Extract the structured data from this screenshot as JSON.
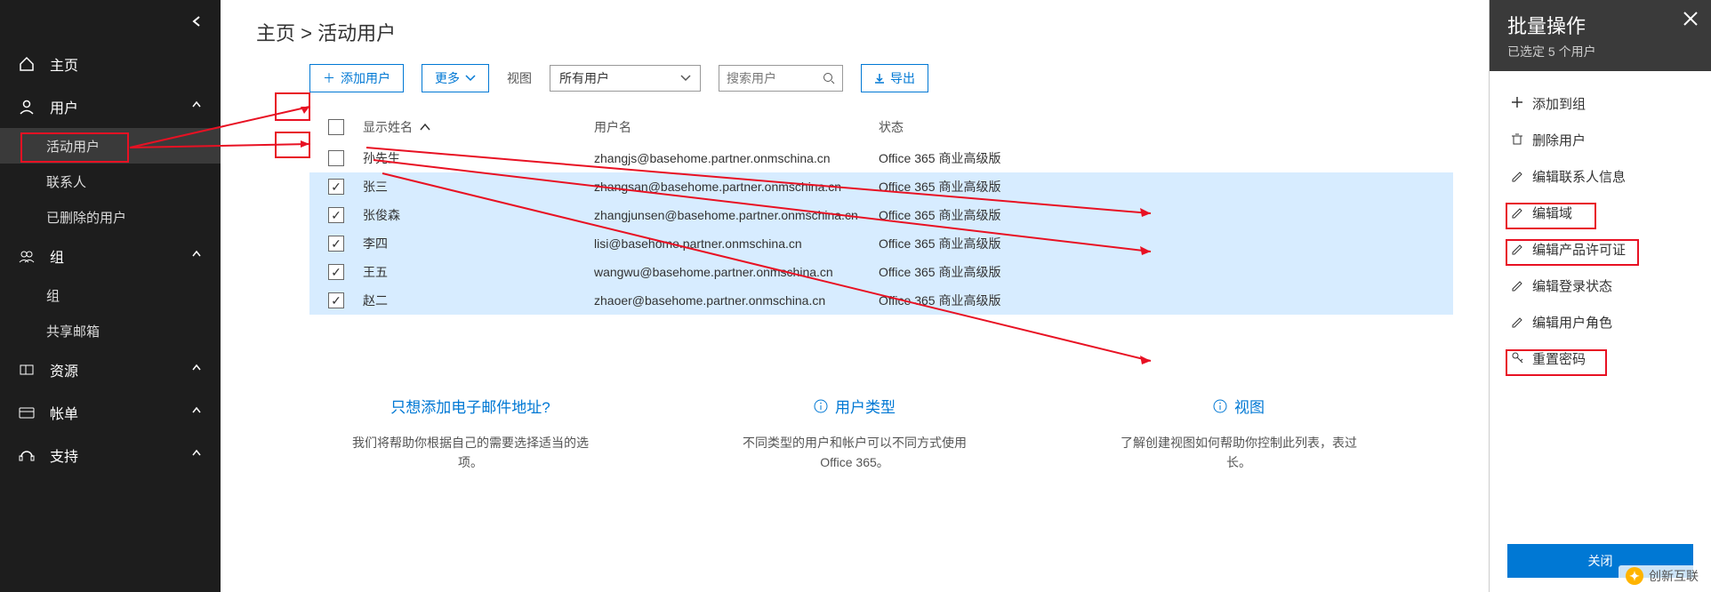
{
  "breadcrumb": "主页 > 活动用户",
  "sidebar": {
    "items": [
      {
        "label": "主页",
        "icon": "home"
      },
      {
        "label": "用户",
        "icon": "user",
        "expand": true
      },
      {
        "label": "活动用户",
        "sub": true,
        "active": true
      },
      {
        "label": "联系人",
        "sub": true
      },
      {
        "label": "已删除的用户",
        "sub": true
      },
      {
        "label": "组",
        "icon": "group",
        "expand": true
      },
      {
        "label": "组",
        "sub": true
      },
      {
        "label": "共享邮箱",
        "sub": true
      },
      {
        "label": "资源",
        "icon": "res",
        "expand": true
      },
      {
        "label": "帐单",
        "icon": "card",
        "expand": true
      },
      {
        "label": "支持",
        "icon": "support",
        "expand": true
      }
    ]
  },
  "toolbar": {
    "addUser": "添加用户",
    "more": "更多",
    "viewLabel": "视图",
    "viewSelected": "所有用户",
    "searchPlaceholder": "搜索用户",
    "export": "导出"
  },
  "tableHead": {
    "name": "显示姓名",
    "user": "用户名",
    "status": "状态"
  },
  "rows": [
    {
      "selected": false,
      "name": "孙先生",
      "user": "zhangjs@basehome.partner.onmschina.cn",
      "status": "Office 365 商业高级版"
    },
    {
      "selected": true,
      "name": "张三",
      "user": "zhangsan@basehome.partner.onmschina.cn",
      "status": "Office 365 商业高级版"
    },
    {
      "selected": true,
      "name": "张俊森",
      "user": "zhangjunsen@basehome.partner.onmschina.cn",
      "status": "Office 365 商业高级版"
    },
    {
      "selected": true,
      "name": "李四",
      "user": "lisi@basehome.partner.onmschina.cn",
      "status": "Office 365 商业高级版"
    },
    {
      "selected": true,
      "name": "王五",
      "user": "wangwu@basehome.partner.onmschina.cn",
      "status": "Office 365 商业高级版"
    },
    {
      "selected": true,
      "name": "赵二",
      "user": "zhaoer@basehome.partner.onmschina.cn",
      "status": "Office 365 商业高级版"
    }
  ],
  "info": [
    {
      "title": "只想添加电子邮件地址?",
      "body": "我们将帮助你根据自己的需要选择适当的选项。"
    },
    {
      "title": "用户类型",
      "body": "不同类型的用户和帐户可以不同方式使用 Office 365。",
      "icon": true
    },
    {
      "title": "视图",
      "body": "了解创建视图如何帮助你控制此列表，表过长。",
      "icon": true
    }
  ],
  "panel": {
    "title": "批量操作",
    "subtitle": "已选定 5 个用户",
    "actions": [
      {
        "icon": "plus",
        "label": "添加到组"
      },
      {
        "icon": "trash",
        "label": "删除用户"
      },
      {
        "icon": "pencil",
        "label": "编辑联系人信息"
      },
      {
        "icon": "pencil",
        "label": "编辑域"
      },
      {
        "icon": "pencil",
        "label": "编辑产品许可证"
      },
      {
        "icon": "pencil",
        "label": "编辑登录状态"
      },
      {
        "icon": "pencil",
        "label": "编辑用户角色"
      },
      {
        "icon": "key",
        "label": "重置密码"
      }
    ],
    "close": "关闭"
  },
  "watermark": "创新互联"
}
